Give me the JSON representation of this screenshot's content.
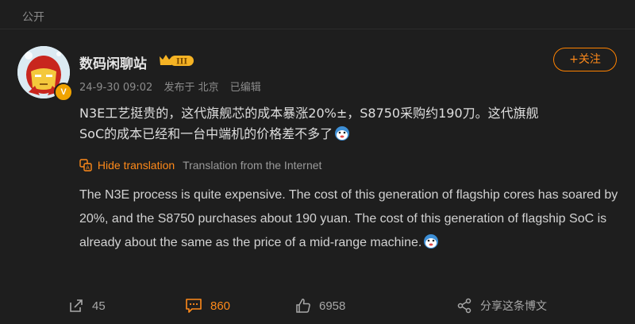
{
  "header": {
    "visibility_label": "公开"
  },
  "author": {
    "name": "数码闲聊站",
    "rank_badge_text": "III",
    "verified_badge": "V",
    "avatar_icon": "ironman-cartoon-avatar"
  },
  "meta": {
    "timestamp": "24-9-30 09:02",
    "location": "发布于 北京",
    "edited": "已编辑"
  },
  "follow_button": {
    "label": "+关注"
  },
  "post": {
    "text_line1": "N3E工艺挺贵的，这代旗舰芯的成本暴涨20%±，S8750采购约190刀。这代旗舰",
    "text_line2": "SoC的成本已经和一台中端机的价格差不多了"
  },
  "translation": {
    "hide_label": "Hide translation",
    "source_label": "Translation from the Internet",
    "text": "The N3E process is quite expensive. The cost of this generation of flagship cores has soared by 20%, and the S8750 purchases about 190 yuan. The cost of this generation of flagship SoC is already about the same as the price of a mid-range machine."
  },
  "actions": {
    "forward_count": "45",
    "comment_count": "860",
    "like_count": "6958",
    "share_label": "分享这条博文"
  },
  "colors": {
    "background": "#1e1e1e",
    "accent": "#ff8200",
    "text_primary": "#dedede",
    "text_muted": "#8c8c8c"
  }
}
